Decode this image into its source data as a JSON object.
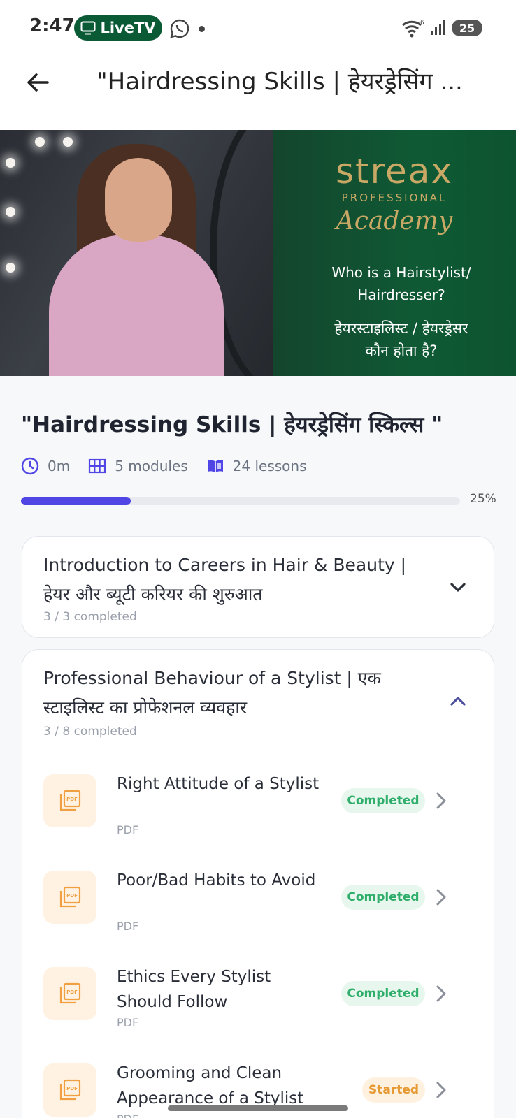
{
  "status_bar": {
    "time": "2:47",
    "livetv_label": "LiveTV",
    "battery": "25"
  },
  "app_bar": {
    "title": "\"Hairdressing Skills | हेयरड्रेसिंग ..."
  },
  "hero": {
    "brand": "streax",
    "brand_sub": "PROFESSIONAL",
    "brand_script": "Academy",
    "question_en_line1": "Who is a Hairstylist/",
    "question_en_line2": "Hairdresser?",
    "question_hi_line1": "हेयरस्टाइलिस्ट / हेयरड्रेसर",
    "question_hi_line2": "कौन होता है?"
  },
  "course": {
    "title": "\"Hairdressing Skills | हेयरड्रेसिंग स्किल्स \"",
    "duration": "0m",
    "modules": "5 modules",
    "lessons": "24 lessons",
    "progress_label": "25%",
    "progress_fraction": 0.25
  },
  "modules": [
    {
      "title": "Introduction to Careers in Hair & Beauty | हेयर और ब्यूटी करियर की शुरुआत",
      "count": "3 / 3 completed",
      "expanded": false
    },
    {
      "title": "Professional Behaviour of a Stylist | एक स्टाइलिस्ट का प्रोफेशनल व्यवहार",
      "count": "3 / 8 completed",
      "expanded": true,
      "lessons": [
        {
          "title": "Right Attitude of a Stylist",
          "type": "PDF",
          "status": "Completed"
        },
        {
          "title": "Poor/Bad Habits to Avoid",
          "type": "PDF",
          "status": "Completed"
        },
        {
          "title": "Ethics Every Stylist Should Follow",
          "type": "PDF",
          "status": "Completed"
        },
        {
          "title": "Grooming and Clean Appearance of a Stylist",
          "type": "PDF",
          "status": "Started"
        }
      ]
    }
  ],
  "thumb_label": "PDF",
  "colors": {
    "accent": "#4f46e5",
    "completed": "#2eae6a",
    "started": "#e59a34",
    "livetv": "#0b5a36",
    "brand_gold": "#c9a865",
    "brand_green": "#0f5a35"
  }
}
